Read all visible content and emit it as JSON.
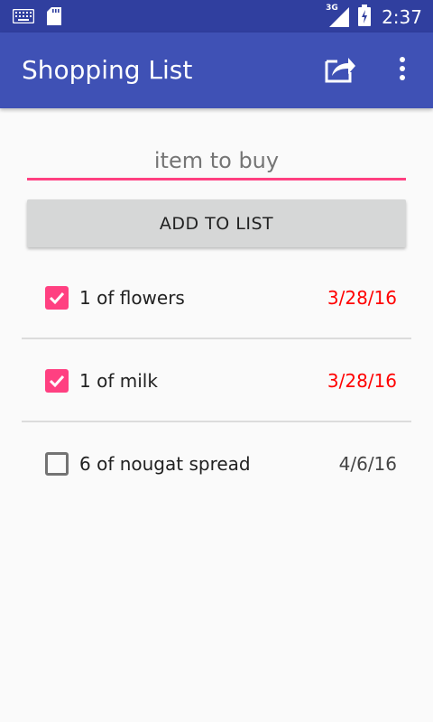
{
  "status_bar": {
    "network": "3G",
    "time": "2:37"
  },
  "app_bar": {
    "title": "Shopping List",
    "share_icon": "share-icon",
    "overflow_icon": "more-vert-icon"
  },
  "input": {
    "placeholder": "item to buy",
    "value": ""
  },
  "add_button": {
    "label": "ADD TO LIST"
  },
  "items": [
    {
      "text": "1 of flowers",
      "date": "3/28/16",
      "checked": true
    },
    {
      "text": "1 of milk",
      "date": "3/28/16",
      "checked": true
    },
    {
      "text": "6 of nougat spread",
      "date": "4/6/16",
      "checked": false
    }
  ],
  "colors": {
    "primary": "#3f51b5",
    "primary_dark": "#303f9f",
    "accent": "#ff4081",
    "date_highlight": "#ff0000"
  }
}
